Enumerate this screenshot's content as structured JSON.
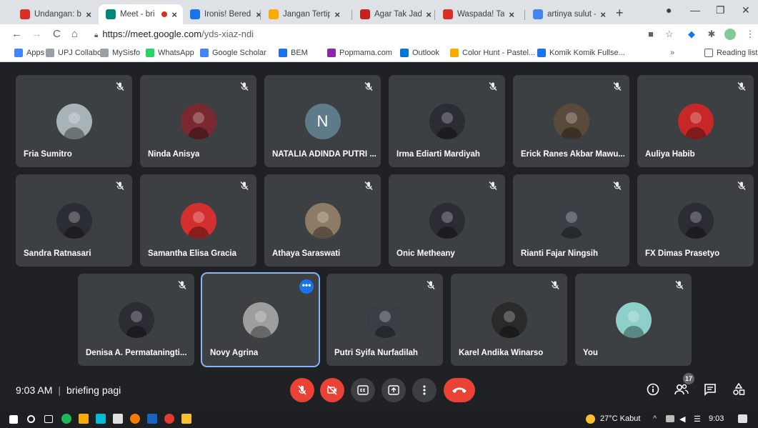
{
  "browser": {
    "tabs": [
      {
        "title": "Undangan: brie",
        "color": "#d93025",
        "active": false
      },
      {
        "title": "Meet - bri",
        "color": "#00897b",
        "active": true
      },
      {
        "title": "Ironis! Beredar",
        "color": "#1a73e8",
        "active": false
      },
      {
        "title": "Jangan Tertipu",
        "color": "#f9ab00",
        "active": false
      },
      {
        "title": "Agar Tak Jadi K",
        "color": "#c5221f",
        "active": false
      },
      {
        "title": "Waspada! Tabu",
        "color": "#d93025",
        "active": false
      },
      {
        "title": "artinya sulut -",
        "color": "#4285f4",
        "active": false
      }
    ],
    "new_tab": "+",
    "url": {
      "scheme": "https://",
      "host": "meet.google.com",
      "path": "/yds-xiaz-ndi"
    },
    "bookmarks": [
      {
        "label": "Apps",
        "color": "#4285f4"
      },
      {
        "label": "UPJ Collabor",
        "color": "#9aa0a6"
      },
      {
        "label": "MySisfo",
        "color": "#9aa0a6"
      },
      {
        "label": "WhatsApp",
        "color": "#25d366"
      },
      {
        "label": "Google Scholar",
        "color": "#4285f4"
      },
      {
        "label": "BEM",
        "color": "#1a73e8"
      },
      {
        "label": "Popmama.com",
        "color": "#8e24aa"
      },
      {
        "label": "Outlook",
        "color": "#0078d4"
      },
      {
        "label": "Color Hunt - Pastel...",
        "color": "#f9ab00"
      },
      {
        "label": "Komik Komik Fullse...",
        "color": "#1a73e8"
      }
    ],
    "bookmarks_more": "»",
    "reading_list": "Reading list"
  },
  "meet": {
    "participants": [
      {
        "name": "Fria Sumitro",
        "avatar": "photo",
        "avatar_color": "#a8b3b8"
      },
      {
        "name": "Ninda Anisya",
        "avatar": "photo",
        "avatar_color": "#7a2a2f"
      },
      {
        "name": "NATALIA ADINDA PUTRI ...",
        "avatar": "initial",
        "initial": "N",
        "avatar_color": "#5f7a88"
      },
      {
        "name": "Irma Ediarti Mardiyah",
        "avatar": "photo",
        "avatar_color": "#2a2d33"
      },
      {
        "name": "Erick Ranes Akbar Mawu...",
        "avatar": "photo",
        "avatar_color": "#5a4a3a"
      },
      {
        "name": "Auliya Habib",
        "avatar": "photo",
        "avatar_color": "#c62828"
      },
      {
        "name": "Sandra Ratnasari",
        "avatar": "photo",
        "avatar_color": "#2b2e34"
      },
      {
        "name": "Samantha Elisa Gracia",
        "avatar": "photo",
        "avatar_color": "#d32f2f"
      },
      {
        "name": "Athaya Saraswati",
        "avatar": "photo",
        "avatar_color": "#8d7b65"
      },
      {
        "name": "Onic Metheany",
        "avatar": "photo",
        "avatar_color": "#2a2d33"
      },
      {
        "name": "Rianti Fajar Ningsih",
        "avatar": "photo",
        "avatar_color": "#3b3f46"
      },
      {
        "name": "FX Dimas Prasetyo",
        "avatar": "photo",
        "avatar_color": "#2a2d33"
      },
      {
        "name": "Denisa A. Permataningti...",
        "avatar": "photo",
        "avatar_color": "#2a2d33"
      },
      {
        "name": "Novy Agrina",
        "avatar": "photo",
        "avatar_color": "#9e9e9e",
        "speaking": true
      },
      {
        "name": "Putri Syifa Nurfadilah",
        "avatar": "photo",
        "avatar_color": "#3a3e45"
      },
      {
        "name": "Karel Andika Winarso",
        "avatar": "photo",
        "avatar_color": "#2a2a2a"
      },
      {
        "name": "You",
        "avatar": "photo",
        "avatar_color": "#8fcfc9"
      }
    ],
    "more_options_label": "•••",
    "time": "9:03 AM",
    "separator": "|",
    "meeting_name": "briefing pagi",
    "participant_count": "17"
  },
  "taskbar": {
    "weather": "27°C Kabut",
    "clock": "9:03"
  }
}
